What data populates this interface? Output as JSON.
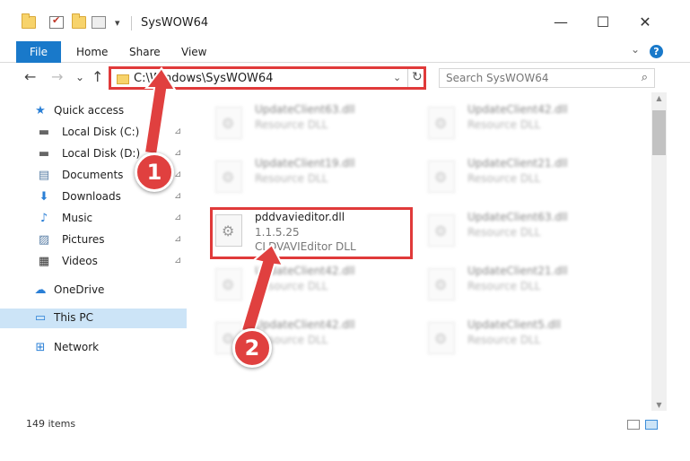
{
  "window": {
    "title": "SysWOW64",
    "minimize": "—",
    "maximize": "☐",
    "close": "✕"
  },
  "quick_access_toolbar": {
    "dropdown": "▾"
  },
  "ribbon": {
    "tabs": [
      "File",
      "Home",
      "Share",
      "View"
    ],
    "help": "?",
    "expand": "⌄"
  },
  "nav": {
    "back": "←",
    "forward": "→",
    "recent": "⌄",
    "up": "↑"
  },
  "address": {
    "path": "C:\\Windows\\SysWOW64",
    "dropdown": "⌄",
    "refresh": "↻"
  },
  "search": {
    "placeholder": "Search SysWOW64",
    "icon": "⌕"
  },
  "sidebar": {
    "items": [
      {
        "label": "Quick access",
        "icon": "★",
        "icon_name": "star-icon",
        "pinned": false
      },
      {
        "label": "Local Disk (C:)",
        "icon": "▬",
        "icon_name": "drive-icon",
        "pinned": true
      },
      {
        "label": "Local Disk (D:)",
        "icon": "▬",
        "icon_name": "drive-icon",
        "pinned": true
      },
      {
        "label": "Documents",
        "icon": "▤",
        "icon_name": "documents-icon",
        "pinned": true
      },
      {
        "label": "Downloads",
        "icon": "⬇",
        "icon_name": "downloads-icon",
        "pinned": true
      },
      {
        "label": "Music",
        "icon": "♪",
        "icon_name": "music-icon",
        "pinned": true
      },
      {
        "label": "Pictures",
        "icon": "▨",
        "icon_name": "pictures-icon",
        "pinned": true
      },
      {
        "label": "Videos",
        "icon": "▦",
        "icon_name": "videos-icon",
        "pinned": true
      },
      {
        "label": "OneDrive",
        "icon": "☁",
        "icon_name": "onedrive-icon",
        "pinned": false
      },
      {
        "label": "This PC",
        "icon": "▭",
        "icon_name": "computer-icon",
        "pinned": false
      },
      {
        "label": "Network",
        "icon": "⊞",
        "icon_name": "network-icon",
        "pinned": false
      }
    ],
    "pin_glyph": "📌"
  },
  "files": [
    {
      "name": "UpdateClient63.dll",
      "desc": "Resource DLL"
    },
    {
      "name": "UpdateClient42.dll",
      "desc": "Resource DLL"
    },
    {
      "name": "UpdateClient19.dll",
      "desc": "Resource DLL"
    },
    {
      "name": "UpdateClient21.dll",
      "desc": "Resource DLL"
    },
    {
      "name": "pddvavieditor.dll",
      "version": "1.1.5.25",
      "desc": "CLDVAVIEditor DLL"
    },
    {
      "name": "UpdateClient63.dll",
      "desc": "Resource DLL"
    },
    {
      "name": "UpdateClient42.dll",
      "desc": "Resource DLL"
    },
    {
      "name": "UpdateClient21.dll",
      "desc": "Resource DLL"
    },
    {
      "name": "UpdateClient42.dll",
      "desc": "Resource DLL"
    },
    {
      "name": "UpdateClient5.dll",
      "desc": "Resource DLL"
    }
  ],
  "status": {
    "item_count": "149 items"
  },
  "annotations": {
    "step1": "1",
    "step2": "2",
    "color": "#e0403f"
  }
}
